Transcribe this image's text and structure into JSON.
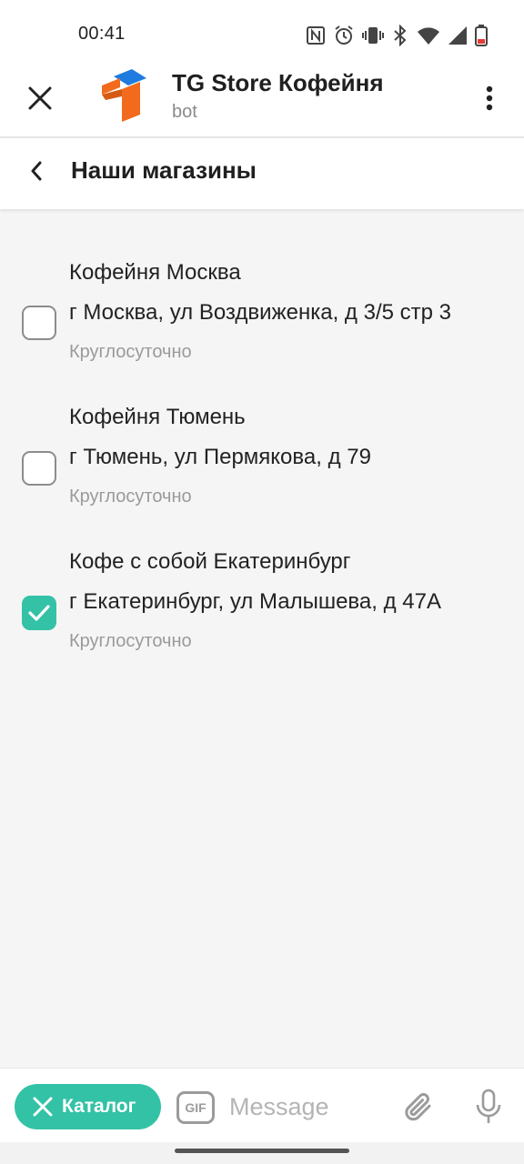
{
  "status_bar": {
    "time": "00:41",
    "icons": [
      "nfc-icon",
      "alarm-icon",
      "vibrate-icon",
      "bluetooth-icon",
      "wifi-icon",
      "signal-icon",
      "battery-icon"
    ]
  },
  "header": {
    "bot_name": "TG Store Кофейня",
    "bot_subtitle": "bot",
    "icons": {
      "close": "close-icon",
      "logo": "bot-logo",
      "more": "more-vert-icon"
    }
  },
  "page": {
    "title": "Наши магазины",
    "back_icon": "chevron-left-icon"
  },
  "stores": [
    {
      "name": "Кофейня Москва",
      "address": "г Москва, ул Воздвиженка, д 3/5 стр 3",
      "hours": "Круглосуточно",
      "selected": false
    },
    {
      "name": "Кофейня Тюмень",
      "address": "г Тюмень, ул Пермякова, д 79",
      "hours": "Круглосуточно",
      "selected": false
    },
    {
      "name": "Кофе с собой Екатеринбург",
      "address": "г Екатеринбург, ул Малышева, д 47А",
      "hours": "Круглосуточно",
      "selected": true
    }
  ],
  "bottom_bar": {
    "catalog_label": "Каталог",
    "gif_label": "GIF",
    "message_placeholder": "Message",
    "message_value": "",
    "icons": {
      "catalog": "close-icon",
      "attach": "paperclip-icon",
      "mic": "microphone-icon"
    }
  },
  "colors": {
    "accent": "#33c2a6",
    "logo_orange": "#f26b1d",
    "logo_blue": "#1e7be0",
    "background": "#f5f5f5"
  }
}
